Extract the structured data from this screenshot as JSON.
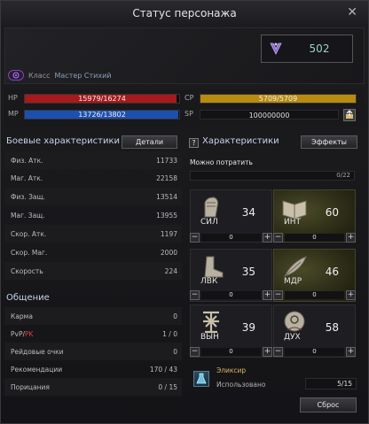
{
  "window": {
    "title": "Статус персонажа",
    "close_symbol": "✕"
  },
  "power": {
    "value": "502",
    "icon": "power-crest-icon"
  },
  "class": {
    "label": "Класс",
    "value": "Мастер Стихий",
    "icon": "class-emblem-icon"
  },
  "vitals": {
    "hp": {
      "label": "HP",
      "text": "15979/16274",
      "fraction": 0.982,
      "color": "#a8191c"
    },
    "mp": {
      "label": "MP",
      "text": "13726/13802",
      "fraction": 0.994,
      "color": "#1d4fb0"
    },
    "cp": {
      "label": "CP",
      "text": "5709/5709",
      "fraction": 1.0,
      "color": "#b88a10"
    },
    "sp": {
      "label": "SP",
      "text": "100000000"
    }
  },
  "combat": {
    "title": "Боевые характеристики",
    "details_label": "Детали",
    "rows": [
      {
        "label": "Физ. Атк.",
        "value": "11733"
      },
      {
        "label": "Маг. Атк.",
        "value": "22158"
      },
      {
        "label": "Физ. Защ.",
        "value": "13514"
      },
      {
        "label": "Маг. Защ.",
        "value": "13955"
      },
      {
        "label": "Скор. Атк.",
        "value": "1197"
      },
      {
        "label": "Скор. Маг.",
        "value": "2000"
      },
      {
        "label": "Скорость",
        "value": "224"
      }
    ]
  },
  "social": {
    "title": "Общение",
    "rows": [
      {
        "label": "Карма",
        "value": "0"
      },
      {
        "label": "PvP/",
        "label_red": "PK",
        "value": "1 / 0"
      },
      {
        "label": "Рейдовые очки",
        "value": "0"
      },
      {
        "label": "Рекомендации",
        "value": "170 / 43"
      },
      {
        "label": "Порицания",
        "value": "0 / 15"
      }
    ]
  },
  "attributes": {
    "title": "Характеристики",
    "help_symbol": "?",
    "effects_label": "Эффекты",
    "available_label": "Можно потратить",
    "available_value": "0/22",
    "stats": [
      {
        "name": "СИЛ",
        "value": "34",
        "points": "0",
        "highlight": false,
        "icon": "strength-fist-icon"
      },
      {
        "name": "ИНТ",
        "value": "60",
        "points": "0",
        "highlight": true,
        "icon": "intelligence-book-icon"
      },
      {
        "name": "ЛВК",
        "value": "35",
        "points": "0",
        "highlight": false,
        "icon": "dexterity-boot-icon"
      },
      {
        "name": "МДР",
        "value": "46",
        "points": "0",
        "highlight": true,
        "icon": "wisdom-feather-icon"
      },
      {
        "name": "ВЫН",
        "value": "39",
        "points": "0",
        "highlight": false,
        "icon": "constitution-glyph-icon"
      },
      {
        "name": "ДУХ",
        "value": "58",
        "points": "0",
        "highlight": false,
        "icon": "mentality-head-icon"
      }
    ]
  },
  "elixir": {
    "name": "Эликсир",
    "used_label": "Использовано",
    "used_value": "5/15",
    "icon": "elixir-icon"
  },
  "reset_label": "Сброс"
}
